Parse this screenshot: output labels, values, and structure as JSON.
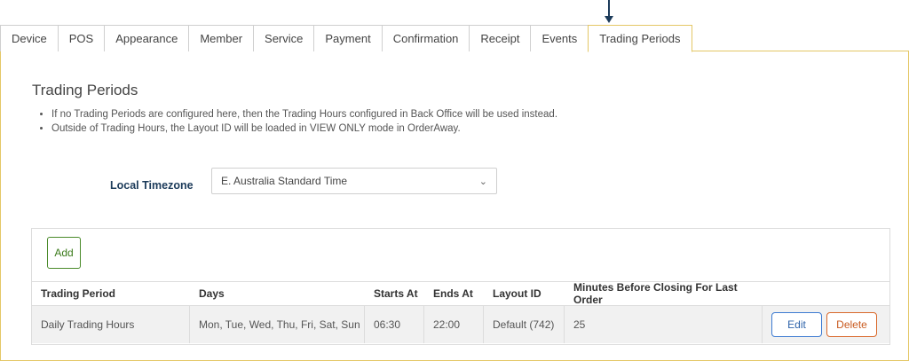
{
  "tabs": [
    {
      "label": "Device"
    },
    {
      "label": "POS"
    },
    {
      "label": "Appearance"
    },
    {
      "label": "Member"
    },
    {
      "label": "Service"
    },
    {
      "label": "Payment"
    },
    {
      "label": "Confirmation"
    },
    {
      "label": "Receipt"
    },
    {
      "label": "Events"
    },
    {
      "label": "Trading Periods"
    }
  ],
  "active_tab": "Trading Periods",
  "section": {
    "title": "Trading Periods",
    "notes": [
      "If no Trading Periods are configured here, then the Trading Hours configured in Back Office will be used instead.",
      "Outside of Trading Hours, the Layout ID will be loaded in VIEW ONLY mode in OrderAway."
    ]
  },
  "timezone": {
    "label": "Local Timezone",
    "value": "E. Australia Standard Time"
  },
  "table": {
    "add_label": "Add",
    "headers": [
      "Trading Period",
      "Days",
      "Starts At",
      "Ends At",
      "Layout ID",
      "Minutes Before Closing For Last Order"
    ],
    "rows": [
      {
        "trading_period": "Daily Trading Hours",
        "days": "Mon, Tue, Wed, Thu, Fri, Sat, Sun",
        "starts_at": "06:30",
        "ends_at": "22:00",
        "layout_id": "Default (742)",
        "minutes": "25",
        "edit_label": "Edit",
        "delete_label": "Delete"
      }
    ]
  },
  "colors": {
    "accent_border": "#e4c766",
    "label_navy": "#1c3b5a",
    "add_green": "#4a8a2a",
    "edit_blue": "#3d7bd1",
    "delete_orange": "#d9682a"
  }
}
